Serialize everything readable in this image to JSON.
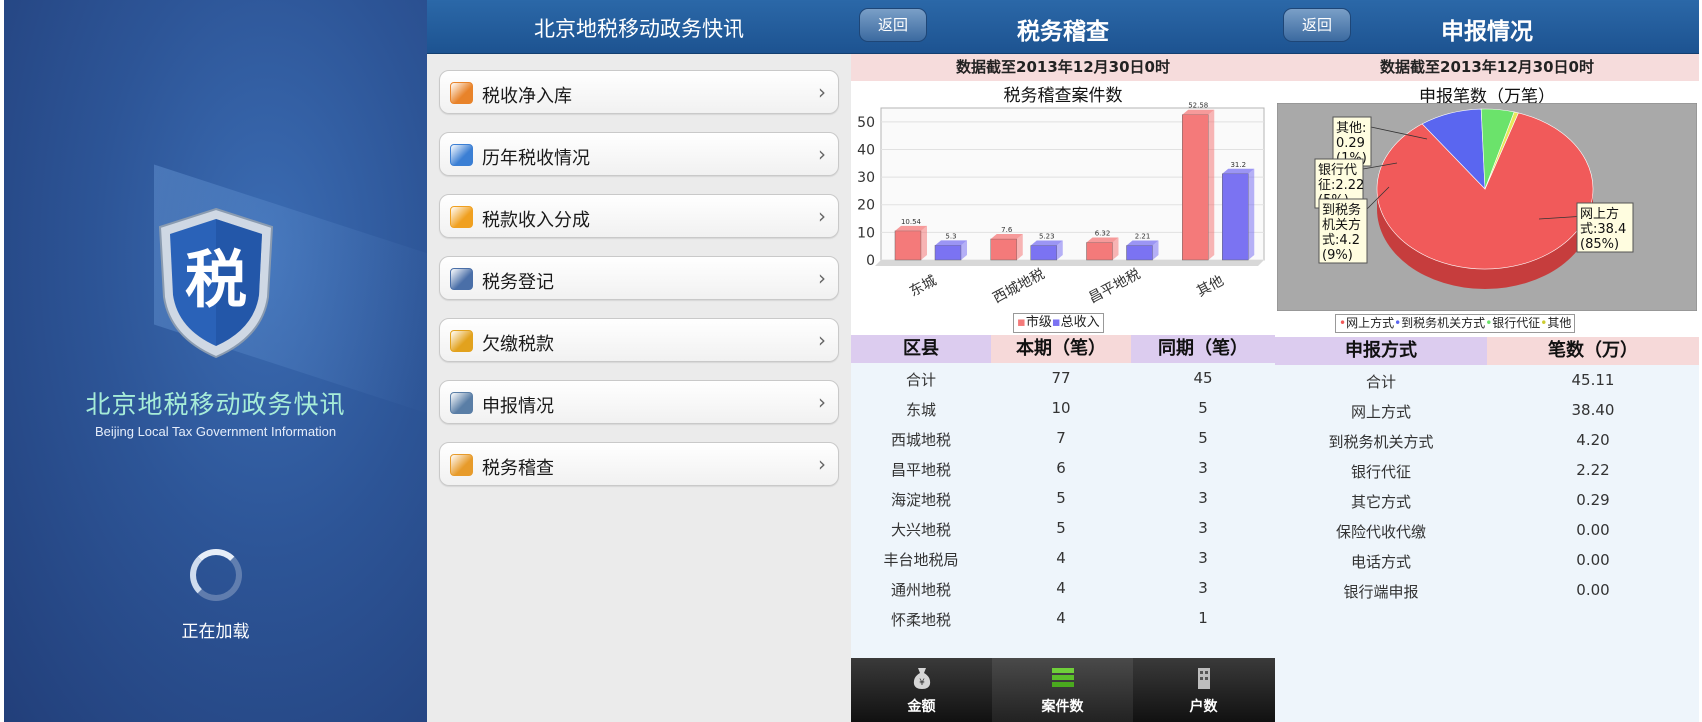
{
  "splash": {
    "logo_char": "税",
    "app_title": "北京地税移动政务快讯",
    "app_subtitle": "Beijing Local Tax Government Information",
    "loading": "正在加载"
  },
  "menu": {
    "title": "北京地税移动政务快讯",
    "items": [
      {
        "label": "税收净入库",
        "icon": "house-tax-icon",
        "color": "#e8832a"
      },
      {
        "label": "历年税收情况",
        "icon": "globe-chart-icon",
        "color": "#3b7fd4"
      },
      {
        "label": "税款收入分成",
        "icon": "split-chart-icon",
        "color": "#f0a020"
      },
      {
        "label": "税务登记",
        "icon": "bar-register-icon",
        "color": "#4a6fa8"
      },
      {
        "label": "欠缴税款",
        "icon": "arrears-coin-icon",
        "color": "#e2a21e"
      },
      {
        "label": "申报情况",
        "icon": "magnifier-doc-icon",
        "color": "#5a7ea6"
      },
      {
        "label": "税务稽查",
        "icon": "wallet-icon",
        "color": "#e79b2b"
      }
    ]
  },
  "audit": {
    "back": "返回",
    "title": "税务稽查",
    "as_of": "数据截至2013年12月30日0时",
    "chart_title": "税务稽查案件数",
    "legend": [
      "市级",
      "总收入"
    ],
    "table_headers": [
      "区县",
      "本期（笔）",
      "同期（笔）"
    ],
    "rows": [
      [
        "合计",
        "77",
        "45"
      ],
      [
        "东城",
        "10",
        "5"
      ],
      [
        "西城地税",
        "7",
        "5"
      ],
      [
        "昌平地税",
        "6",
        "3"
      ],
      [
        "海淀地税",
        "5",
        "3"
      ],
      [
        "大兴地税",
        "5",
        "3"
      ],
      [
        "丰台地税局",
        "4",
        "3"
      ],
      [
        "通州地税",
        "4",
        "3"
      ],
      [
        "怀柔地税",
        "4",
        "1"
      ]
    ],
    "tabs": [
      "金额",
      "案件数",
      "户数"
    ]
  },
  "declare": {
    "back": "返回",
    "title": "申报情况",
    "as_of": "数据截至2013年12月30日0时",
    "chart_title": "申报笔数（万笔）",
    "legend": [
      "网上方式",
      "到税务机关方式",
      "银行代征",
      "其他"
    ],
    "callouts": {
      "other": [
        "其他:",
        "0.29",
        "(1%)"
      ],
      "bank": [
        "银行代",
        "征:2.22",
        "(5%)"
      ],
      "office": [
        "到税务",
        "机关方",
        "式:4.2",
        "(9%)"
      ],
      "online": [
        "网上方",
        "式:38.4",
        "(85%)"
      ]
    },
    "table_headers": [
      "申报方式",
      "笔数（万）"
    ],
    "rows": [
      [
        "合计",
        "45.11"
      ],
      [
        "网上方式",
        "38.40"
      ],
      [
        "到税务机关方式",
        "4.20"
      ],
      [
        "银行代征",
        "2.22"
      ],
      [
        "其它方式",
        "0.29"
      ],
      [
        "保险代收代缴",
        "0.00"
      ],
      [
        "电话方式",
        "0.00"
      ],
      [
        "银行端申报",
        "0.00"
      ]
    ]
  },
  "chart_data": [
    {
      "type": "bar",
      "title": "税务稽查案件数",
      "categories": [
        "东城",
        "西城地税",
        "昌平地税",
        "其他"
      ],
      "series": [
        {
          "name": "市级",
          "values": [
            10.54,
            7.6,
            6.32,
            52.58
          ],
          "color": "#f47a7a"
        },
        {
          "name": "总收入",
          "values": [
            5.3,
            5.23,
            5.23,
            31.2
          ],
          "color": "#7b73f2"
        }
      ],
      "bar_labels": [
        [
          "10.54",
          "7.6",
          "6.32",
          "52.58"
        ],
        [
          "5.3",
          "5.23",
          "2.21",
          "31.2"
        ]
      ],
      "yticks": [
        "0",
        "10",
        "20",
        "30",
        "40",
        "50"
      ],
      "ylim": [
        0,
        55
      ],
      "grid": true,
      "legend_position": "bottom"
    },
    {
      "type": "pie",
      "title": "申报笔数（万笔）",
      "labels": [
        "网上方式",
        "到税务机关方式",
        "银行代征",
        "其他"
      ],
      "values": [
        38.4,
        4.2,
        2.22,
        0.29
      ],
      "colors": [
        "#f15a5a",
        "#5a66f0",
        "#6be36b",
        "#e8e85a"
      ],
      "legend_position": "bottom"
    }
  ]
}
